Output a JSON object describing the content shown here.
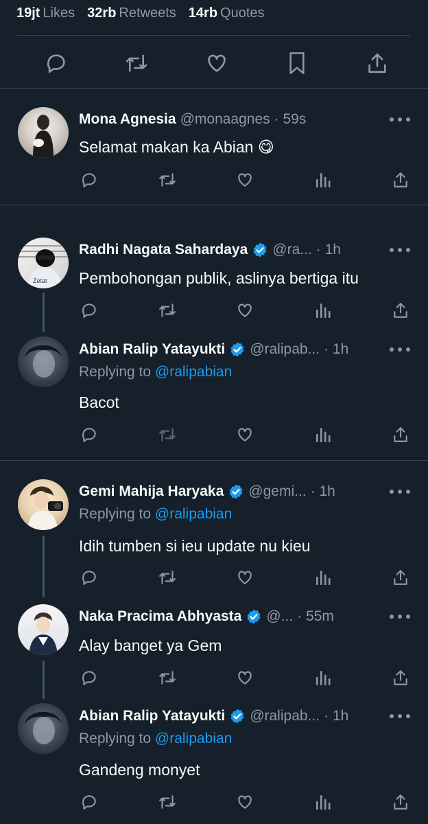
{
  "stats": [
    {
      "count": "19jt",
      "label": "Likes"
    },
    {
      "count": "32rb",
      "label": "Retweets"
    },
    {
      "count": "14rb",
      "label": "Quotes"
    }
  ],
  "colors": {
    "background": "#15202b",
    "text": "#f7f9f9",
    "muted": "#8b98a5",
    "link": "#1d9bf0",
    "divider": "#38444d"
  },
  "tweets": [
    {
      "name": "Mona Agnesia",
      "handle": "@monaagnes",
      "time": "· 59s",
      "verified": false,
      "reply_to_prefix": "",
      "reply_to_handle": "",
      "text": "Selamat makan ka Abian 😋"
    },
    {
      "name": "Radhi Nagata Sahardaya",
      "handle": "@ra...",
      "time": "· 1h",
      "verified": true,
      "reply_to_prefix": "",
      "reply_to_handle": "",
      "text": "Pembohongan publik, aslinya bertiga itu"
    },
    {
      "name": "Abian Ralip Yatayukti",
      "handle": "@ralipab...",
      "time": "· 1h",
      "verified": true,
      "reply_to_prefix": "Replying to",
      "reply_to_handle": "@ralipabian",
      "text": "Bacot"
    },
    {
      "name": "Gemi Mahija Haryaka",
      "handle": "@gemi...",
      "time": "· 1h",
      "verified": true,
      "reply_to_prefix": "Replying to",
      "reply_to_handle": "@ralipabian",
      "text": "Idih tumben si ieu update nu kieu"
    },
    {
      "name": "Naka Pracima Abhyasta",
      "handle": "@...",
      "time": "· 55m",
      "verified": true,
      "reply_to_prefix": "",
      "reply_to_handle": "",
      "text": "Alay banget ya Gem"
    },
    {
      "name": "Abian Ralip Yatayukti",
      "handle": "@ralipab...",
      "time": "· 1h",
      "verified": true,
      "reply_to_prefix": "Replying to",
      "reply_to_handle": "@ralipabian",
      "text": "Gandeng monyet"
    }
  ],
  "icons": {
    "main_actions": [
      "reply-icon",
      "retweet-icon",
      "like-icon",
      "bookmark-icon",
      "share-icon"
    ],
    "tweet_actions": [
      "reply-icon",
      "retweet-icon",
      "like-icon",
      "views-icon",
      "share-icon"
    ],
    "more": "more-icon",
    "verified": "verified-badge-icon"
  }
}
